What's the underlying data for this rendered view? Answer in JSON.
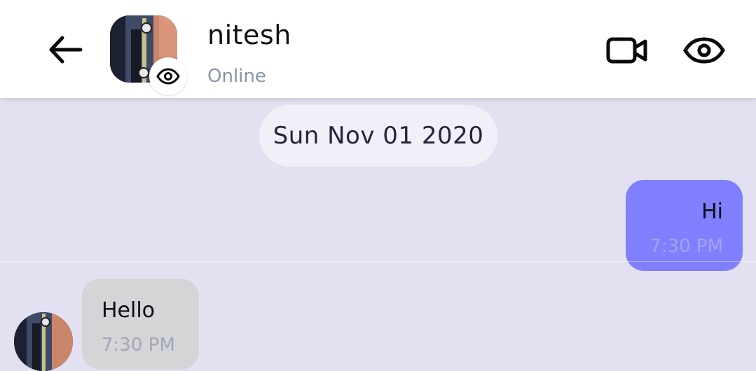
{
  "header": {
    "contact_name": "nitesh",
    "status": "Online",
    "back_icon": "arrow-left-icon",
    "video_icon": "video-camera-icon",
    "view_icon": "eye-icon"
  },
  "conversation": {
    "date_separator": "Sun Nov 01 2020",
    "messages": [
      {
        "direction": "sent",
        "text": "Hi",
        "time": "7:30 PM"
      },
      {
        "direction": "received",
        "text": "Hello",
        "time": "7:30 PM"
      }
    ]
  },
  "colors": {
    "background": "#e3e1f1",
    "sent_bubble": "#8080ff",
    "received_bubble": "#d5d5d7",
    "status_text": "#8a93a8"
  }
}
